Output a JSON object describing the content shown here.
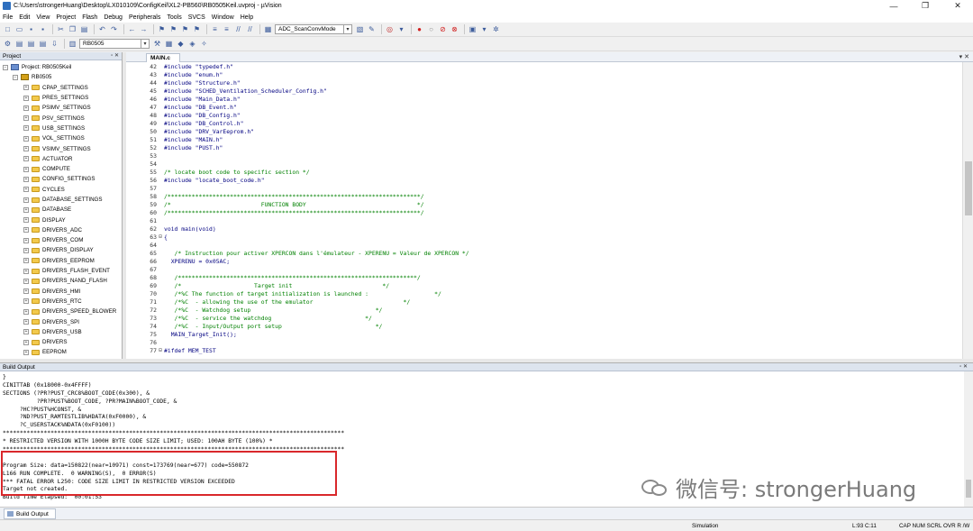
{
  "window": {
    "title": "C:\\Users\\strongerHuang\\Desktop\\LX010109\\ConfigKeil\\XL2-PB560\\RB0505Keil.uvproj - µVision",
    "minimize": "—",
    "maximize": "❐",
    "close": "✕"
  },
  "menu": [
    "File",
    "Edit",
    "View",
    "Project",
    "Flash",
    "Debug",
    "Peripherals",
    "Tools",
    "SVCS",
    "Window",
    "Help"
  ],
  "toolbar": {
    "target_combo": "ADC_ScanConvMode",
    "target_select": "RB0505"
  },
  "project_panel": {
    "title": "Project",
    "controls": "▫ ✕",
    "root": "Project: RB0505Keil",
    "target": "RB0505",
    "folders": [
      "CPAP_SETTINGS",
      "PRES_SETTINGS",
      "PSIMV_SETTINGS",
      "PSV_SETTINGS",
      "USB_SETTINGS",
      "VOL_SETTINGS",
      "VSIMV_SETTINGS",
      "ACTUATOR",
      "COMPUTE",
      "CONFIG_SETTINGS",
      "CYCLES",
      "DATABASE_SETTINGS",
      "DATABASE",
      "DISPLAY",
      "DRIVERS_ADC",
      "DRIVERS_COM",
      "DRIVERS_DISPLAY",
      "DRIVERS_EEPROM",
      "DRIVERS_FLASH_EVENT",
      "DRIVERS_NAND_FLASH",
      "DRIVERS_HMI",
      "DRIVERS_RTC",
      "DRIVERS_SPEED_BLOWER",
      "DRIVERS_SPI",
      "DRIVERS_USB",
      "DRIVERS",
      "EEPROM"
    ]
  },
  "editor": {
    "tab": "MAIN.c",
    "tab_controls": "▾ ✕",
    "lines": [
      {
        "n": "42",
        "g": "",
        "t": "#include \"typedef.h\"",
        "c": "kw"
      },
      {
        "n": "43",
        "g": "",
        "t": "#include \"enum.h\"",
        "c": "kw"
      },
      {
        "n": "44",
        "g": "",
        "t": "#include \"Structure.h\"",
        "c": "kw"
      },
      {
        "n": "45",
        "g": "",
        "t": "#include \"SCHED_Ventilation_Scheduler_Config.h\"",
        "c": "kw"
      },
      {
        "n": "46",
        "g": "",
        "t": "#include \"Main_Data.h\"",
        "c": "kw"
      },
      {
        "n": "47",
        "g": "",
        "t": "#include \"DB_Event.h\"",
        "c": "kw"
      },
      {
        "n": "48",
        "g": "",
        "t": "#include \"DB_Config.h\"",
        "c": "kw"
      },
      {
        "n": "49",
        "g": "",
        "t": "#include \"DB_Control.h\"",
        "c": "kw"
      },
      {
        "n": "50",
        "g": "",
        "t": "#include \"DRV_VarEeprom.h\"",
        "c": "kw"
      },
      {
        "n": "51",
        "g": "",
        "t": "#include \"MAIN.h\"",
        "c": "kw"
      },
      {
        "n": "52",
        "g": "",
        "t": "#include \"PUST.h\"",
        "c": "kw"
      },
      {
        "n": "53",
        "g": "",
        "t": "",
        "c": "kw"
      },
      {
        "n": "54",
        "g": "",
        "t": "",
        "c": "kw"
      },
      {
        "n": "55",
        "g": "",
        "t": "/* locate boot code to specific section */",
        "c": "cmt"
      },
      {
        "n": "56",
        "g": "",
        "t": "#include \"locate_boot_code.h\"",
        "c": "kw"
      },
      {
        "n": "57",
        "g": "",
        "t": "",
        "c": "kw"
      },
      {
        "n": "58",
        "g": "",
        "t": "/*************************************************************************/",
        "c": "cmt"
      },
      {
        "n": "59",
        "g": "",
        "t": "/*                          FUNCTION BODY                                */",
        "c": "cmt"
      },
      {
        "n": "60",
        "g": "",
        "t": "/*************************************************************************/",
        "c": "cmt"
      },
      {
        "n": "61",
        "g": "",
        "t": "",
        "c": "kw"
      },
      {
        "n": "62",
        "g": "",
        "t": "void main(void)",
        "c": "kw"
      },
      {
        "n": "63",
        "g": "⊟",
        "t": "{",
        "c": "kw"
      },
      {
        "n": "64",
        "g": "",
        "t": "",
        "c": "kw"
      },
      {
        "n": "65",
        "g": "",
        "t": "   /* Instruction pour activer XPERCON dans l'émulateur - XPERENU = Valeur de XPERCON */",
        "c": "cmt"
      },
      {
        "n": "66",
        "g": "",
        "t": "  XPERENU = 0x05AC;",
        "c": "kw"
      },
      {
        "n": "67",
        "g": "",
        "t": "",
        "c": "kw"
      },
      {
        "n": "68",
        "g": "",
        "t": "   /*********************************************************************/",
        "c": "cmt"
      },
      {
        "n": "69",
        "g": "",
        "t": "   /*                     Target init                          */",
        "c": "cmt"
      },
      {
        "n": "70",
        "g": "",
        "t": "   /*%C The function of target initialization is launched :                   */",
        "c": "cmt"
      },
      {
        "n": "71",
        "g": "",
        "t": "   /*%C  - allowing the use of the emulator                          */",
        "c": "cmt"
      },
      {
        "n": "72",
        "g": "",
        "t": "   /*%C  - Watchdog setup                                    */",
        "c": "cmt"
      },
      {
        "n": "73",
        "g": "",
        "t": "   /*%C  - service the watchdog                           */",
        "c": "cmt"
      },
      {
        "n": "74",
        "g": "",
        "t": "   /*%C  - Input/Output port setup                           */",
        "c": "cmt"
      },
      {
        "n": "75",
        "g": "",
        "t": "  MAIN_Target_Init();",
        "c": "kw"
      },
      {
        "n": "76",
        "g": "",
        "t": "",
        "c": "kw"
      },
      {
        "n": "77",
        "g": "⊟",
        "t": "#ifdef MEM_TEST",
        "c": "kw"
      }
    ]
  },
  "build_output": {
    "title": "Build Output",
    "controls": "▫ ✕",
    "lines": [
      "}",
      "CINITTAB (0x18000-0x4FFFF)",
      "SECTIONS (?PR?PUST_CRC8%BOOT_CODE(0x300), &",
      "          ?PR?PUST%BOOT_CODE, ?PR?MAIN%BOOT_CODE, &",
      "     ?HC?PUST%HCONST, &",
      "     ?ND?PUST_RAMTESTLIB%HDATA(0xF0000), &",
      "     ?C_USERSTACK%NDATA(0xF0100))",
      "****************************************************************************************************",
      "* RESTRICTED VERSION WITH 1000H BYTE CODE SIZE LIMIT; USED: 100AH BYTE (100%) *",
      "****************************************************************************************************",
      "",
      "Program Size: data=150822(near=10971) const=173769(near=677) code=550872",
      "L166 RUN COMPLETE.  0 WARNING(S),  0 ERROR(S)",
      "*** FATAL ERROR L250: CODE SIZE LIMIT IN RESTRICTED VERSION EXCEEDED",
      "Target not created.",
      "Build Time Elapsed:  00:01:53"
    ]
  },
  "bottom_tab": "Build Output",
  "watermark": "微信号: strongerHuang",
  "status": {
    "mode": "Simulation",
    "position": "L:93 C:11",
    "flags": "CAP  NUM  SCRL  OVR  R /W"
  }
}
